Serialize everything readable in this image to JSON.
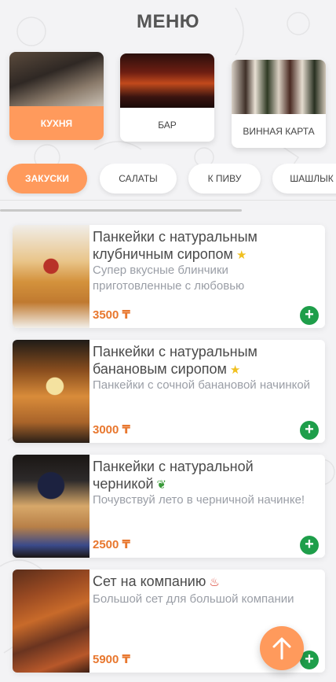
{
  "page": {
    "title": "МЕНЮ"
  },
  "categories": [
    {
      "label": "КУХНЯ",
      "active": true
    },
    {
      "label": "БАР",
      "active": false
    },
    {
      "label": "ВИННАЯ КАРТА",
      "active": false
    }
  ],
  "tabs": [
    {
      "label": "ЗАКУСКИ",
      "active": true
    },
    {
      "label": "САЛАТЫ",
      "active": false
    },
    {
      "label": "К ПИВУ",
      "active": false
    },
    {
      "label": "ШАШЛЫК",
      "active": false
    }
  ],
  "items": [
    {
      "name": "Панкейки с натуральным клубничным сиропом",
      "badge": "star-icon",
      "desc": "Супер вкусные блинчики приготовленные с любовью",
      "price": "3500 ₸"
    },
    {
      "name": "Панкейки с натуральным банановым сиропом",
      "badge": "star-icon",
      "desc": "Панкейки с сочной банановой начинкой",
      "price": "3000 ₸"
    },
    {
      "name": "Панкейки с натуральной черникой",
      "badge": "sprout-icon",
      "desc": "Почувствуй лето в черничной начинке!",
      "price": "2500 ₸"
    },
    {
      "name": "Сет на компанию",
      "badge": "chili-icon",
      "desc": "Большой сет для большой компании",
      "price": "5900 ₸"
    }
  ],
  "colors": {
    "accent": "#ff9a5c",
    "add": "#1e9e4a",
    "price": "#e8772e"
  }
}
